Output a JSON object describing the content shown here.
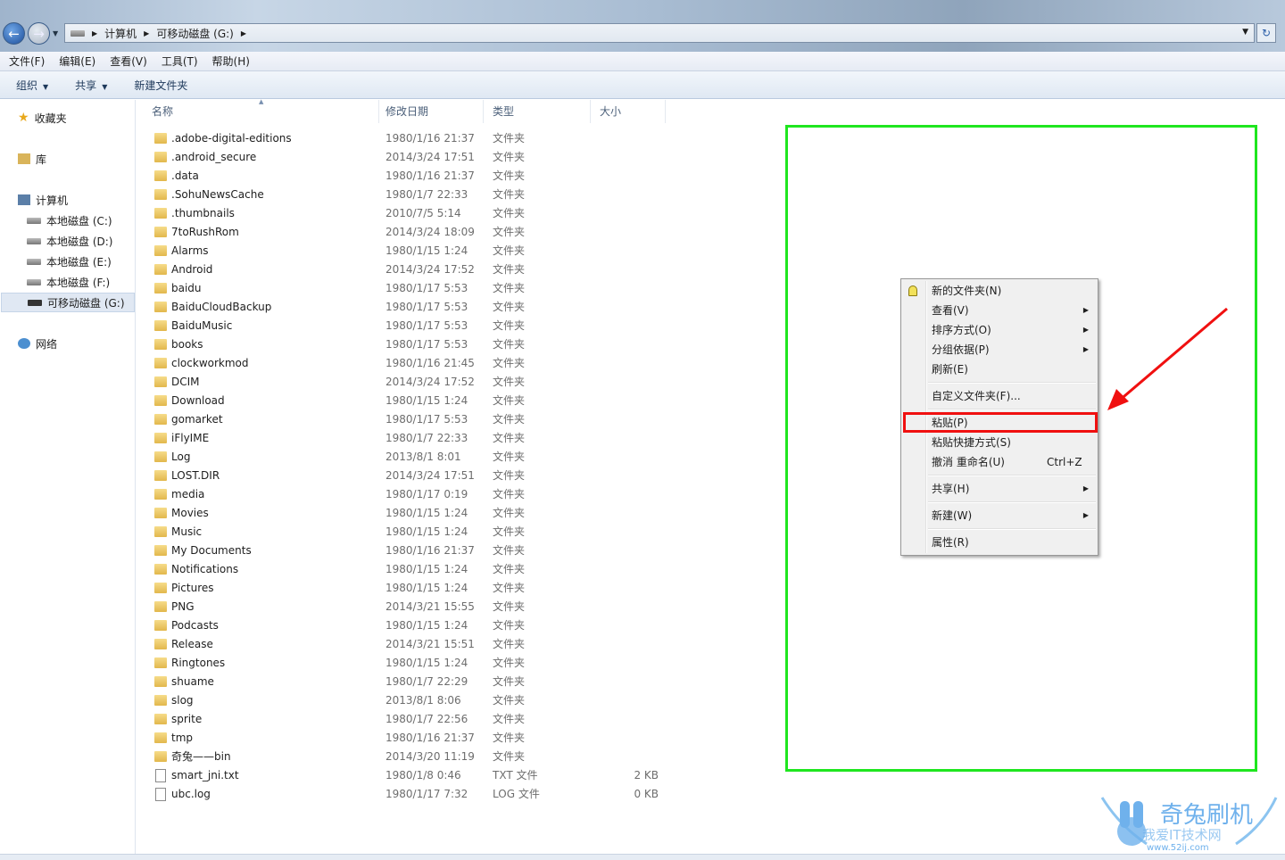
{
  "address": {
    "segments": [
      "计算机",
      "可移动磁盘 (G:)"
    ]
  },
  "menu": [
    "文件(F)",
    "编辑(E)",
    "查看(V)",
    "工具(T)",
    "帮助(H)"
  ],
  "toolbar": {
    "organize": "组织",
    "share": "共享",
    "new_folder": "新建文件夹"
  },
  "sidebar": {
    "favorites": "收藏夹",
    "libraries": "库",
    "computer": "计算机",
    "drives": [
      "本地磁盘 (C:)",
      "本地磁盘 (D:)",
      "本地磁盘 (E:)",
      "本地磁盘 (F:)",
      "可移动磁盘 (G:)"
    ],
    "network": "网络"
  },
  "columns": {
    "name": "名称",
    "date": "修改日期",
    "type": "类型",
    "size": "大小"
  },
  "files": [
    {
      "name": ".adobe-digital-editions",
      "date": "1980/1/16 21:37",
      "type": "文件夹",
      "size": ""
    },
    {
      "name": ".android_secure",
      "date": "2014/3/24 17:51",
      "type": "文件夹",
      "size": ""
    },
    {
      "name": ".data",
      "date": "1980/1/16 21:37",
      "type": "文件夹",
      "size": ""
    },
    {
      "name": ".SohuNewsCache",
      "date": "1980/1/7 22:33",
      "type": "文件夹",
      "size": ""
    },
    {
      "name": ".thumbnails",
      "date": "2010/7/5 5:14",
      "type": "文件夹",
      "size": ""
    },
    {
      "name": "7toRushRom",
      "date": "2014/3/24 18:09",
      "type": "文件夹",
      "size": ""
    },
    {
      "name": "Alarms",
      "date": "1980/1/15 1:24",
      "type": "文件夹",
      "size": ""
    },
    {
      "name": "Android",
      "date": "2014/3/24 17:52",
      "type": "文件夹",
      "size": ""
    },
    {
      "name": "baidu",
      "date": "1980/1/17 5:53",
      "type": "文件夹",
      "size": ""
    },
    {
      "name": "BaiduCloudBackup",
      "date": "1980/1/17 5:53",
      "type": "文件夹",
      "size": ""
    },
    {
      "name": "BaiduMusic",
      "date": "1980/1/17 5:53",
      "type": "文件夹",
      "size": ""
    },
    {
      "name": "books",
      "date": "1980/1/17 5:53",
      "type": "文件夹",
      "size": ""
    },
    {
      "name": "clockworkmod",
      "date": "1980/1/16 21:45",
      "type": "文件夹",
      "size": ""
    },
    {
      "name": "DCIM",
      "date": "2014/3/24 17:52",
      "type": "文件夹",
      "size": ""
    },
    {
      "name": "Download",
      "date": "1980/1/15 1:24",
      "type": "文件夹",
      "size": ""
    },
    {
      "name": "gomarket",
      "date": "1980/1/17 5:53",
      "type": "文件夹",
      "size": ""
    },
    {
      "name": "iFlyIME",
      "date": "1980/1/7 22:33",
      "type": "文件夹",
      "size": ""
    },
    {
      "name": "Log",
      "date": "2013/8/1 8:01",
      "type": "文件夹",
      "size": ""
    },
    {
      "name": "LOST.DIR",
      "date": "2014/3/24 17:51",
      "type": "文件夹",
      "size": ""
    },
    {
      "name": "media",
      "date": "1980/1/17 0:19",
      "type": "文件夹",
      "size": ""
    },
    {
      "name": "Movies",
      "date": "1980/1/15 1:24",
      "type": "文件夹",
      "size": ""
    },
    {
      "name": "Music",
      "date": "1980/1/15 1:24",
      "type": "文件夹",
      "size": ""
    },
    {
      "name": "My Documents",
      "date": "1980/1/16 21:37",
      "type": "文件夹",
      "size": ""
    },
    {
      "name": "Notifications",
      "date": "1980/1/15 1:24",
      "type": "文件夹",
      "size": ""
    },
    {
      "name": "Pictures",
      "date": "1980/1/15 1:24",
      "type": "文件夹",
      "size": ""
    },
    {
      "name": "PNG",
      "date": "2014/3/21 15:55",
      "type": "文件夹",
      "size": ""
    },
    {
      "name": "Podcasts",
      "date": "1980/1/15 1:24",
      "type": "文件夹",
      "size": ""
    },
    {
      "name": "Release",
      "date": "2014/3/21 15:51",
      "type": "文件夹",
      "size": ""
    },
    {
      "name": "Ringtones",
      "date": "1980/1/15 1:24",
      "type": "文件夹",
      "size": ""
    },
    {
      "name": "shuame",
      "date": "1980/1/7 22:29",
      "type": "文件夹",
      "size": ""
    },
    {
      "name": "slog",
      "date": "2013/8/1 8:06",
      "type": "文件夹",
      "size": ""
    },
    {
      "name": "sprite",
      "date": "1980/1/7 22:56",
      "type": "文件夹",
      "size": ""
    },
    {
      "name": "tmp",
      "date": "1980/1/16 21:37",
      "type": "文件夹",
      "size": ""
    },
    {
      "name": "奇兔——bin",
      "date": "2014/3/20 11:19",
      "type": "文件夹",
      "size": ""
    },
    {
      "name": "smart_jni.txt",
      "date": "1980/1/8 0:46",
      "type": "TXT 文件",
      "size": "2 KB"
    },
    {
      "name": "ubc.log",
      "date": "1980/1/17 7:32",
      "type": "LOG 文件",
      "size": "0 KB"
    }
  ],
  "context_menu": [
    {
      "label": "新的文件夹(N)"
    },
    {
      "label": "查看(V)",
      "sub": true
    },
    {
      "label": "排序方式(O)",
      "sub": true
    },
    {
      "label": "分组依据(P)",
      "sub": true
    },
    {
      "label": "刷新(E)"
    },
    {
      "sep": true
    },
    {
      "label": "自定义文件夹(F)..."
    },
    {
      "sep": true
    },
    {
      "label": "粘贴(P)",
      "highlighted": true
    },
    {
      "label": "粘贴快捷方式(S)"
    },
    {
      "label": "撤消 重命名(U)",
      "shortcut": "Ctrl+Z"
    },
    {
      "sep": true
    },
    {
      "label": "共享(H)",
      "sub": true
    },
    {
      "sep": true
    },
    {
      "label": "新建(W)",
      "sub": true
    },
    {
      "sep": true
    },
    {
      "label": "属性(R)"
    }
  ],
  "watermark": {
    "brand": "奇兔刷机",
    "sub": "我爱IT技术网",
    "url": "www.52ij.com"
  },
  "colors": {
    "annotation_box": "#1fe61f",
    "highlight": "#f01010",
    "arrow": "#f01010"
  }
}
